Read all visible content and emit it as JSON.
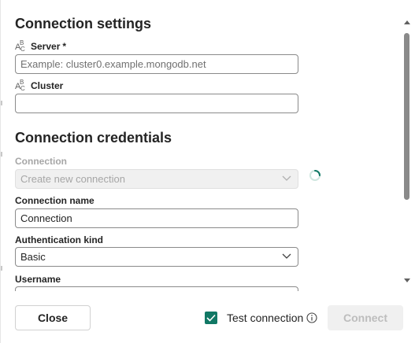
{
  "connection_settings": {
    "title": "Connection settings",
    "server": {
      "label": "Server",
      "required_marker": "*",
      "placeholder": "Example: cluster0.example.mongodb.net",
      "value": ""
    },
    "cluster": {
      "label": "Cluster",
      "value": ""
    }
  },
  "connection_credentials": {
    "title": "Connection credentials",
    "connection": {
      "label": "Connection",
      "selected": "Create new connection",
      "disabled": true
    },
    "connection_name": {
      "label": "Connection name",
      "value": "Connection"
    },
    "authentication_kind": {
      "label": "Authentication kind",
      "selected": "Basic"
    },
    "username": {
      "label": "Username"
    }
  },
  "footer": {
    "close_label": "Close",
    "test_connection_label": "Test connection",
    "test_connection_checked": true,
    "connect_label": "Connect"
  },
  "colors": {
    "accent": "#117865",
    "disabled_text": "#a6a6a6",
    "border": "#8a8a8a"
  },
  "icons": {
    "field_type": "abc-text-icon",
    "loading": "spinner-icon",
    "info": "info-icon",
    "dropdown": "chevron-down-icon"
  }
}
